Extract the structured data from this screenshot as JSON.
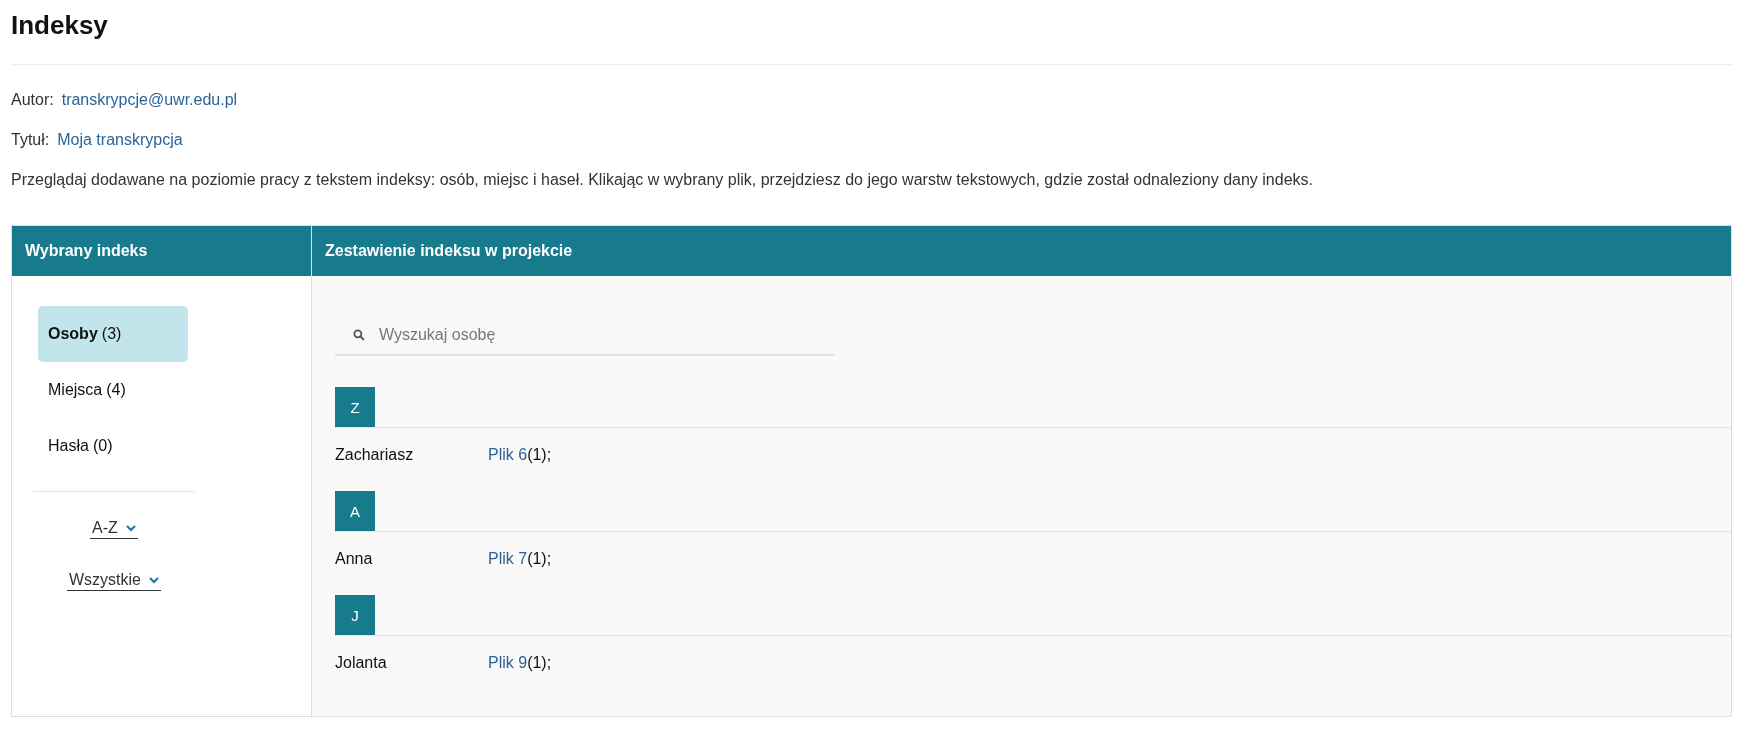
{
  "page": {
    "title": "Indeksy"
  },
  "meta": [
    {
      "label": "Autor:",
      "value": "transkrypcje@uwr.edu.pl"
    },
    {
      "label": "Tytuł:",
      "value": "Moja transkrypcja"
    }
  ],
  "description": "Przeglądaj dodawane na poziomie pracy z tekstem indeksy: osób, miejsc i haseł. Klikając w wybrany plik, przejdziesz do jego warstw tekstowych, gdzie został odnaleziony dany indeks.",
  "left_panel": {
    "heading": "Wybrany indeks",
    "categories": [
      {
        "name": "Osoby",
        "count": "(3)",
        "selected": true
      },
      {
        "name": "Miejsca",
        "count": "(4)",
        "selected": false
      },
      {
        "name": "Hasła",
        "count": "(0)",
        "selected": false
      }
    ],
    "sort": {
      "value": "A-Z"
    },
    "filter": {
      "value": "Wszystkie"
    }
  },
  "right_panel": {
    "heading": "Zestawienie indeksu w projekcie",
    "search": {
      "placeholder": "Wyszukaj osobę"
    },
    "groups": [
      {
        "letter": "Z",
        "entries": [
          {
            "name": "Zachariasz",
            "files": [
              {
                "link": "Plik 6",
                "count": "(1);"
              }
            ]
          }
        ]
      },
      {
        "letter": "A",
        "entries": [
          {
            "name": "Anna",
            "files": [
              {
                "link": "Plik 7",
                "count": "(1);"
              }
            ]
          }
        ]
      },
      {
        "letter": "J",
        "entries": [
          {
            "name": "Jolanta",
            "files": [
              {
                "link": "Plik 9",
                "count": "(1);"
              }
            ]
          }
        ]
      }
    ]
  }
}
